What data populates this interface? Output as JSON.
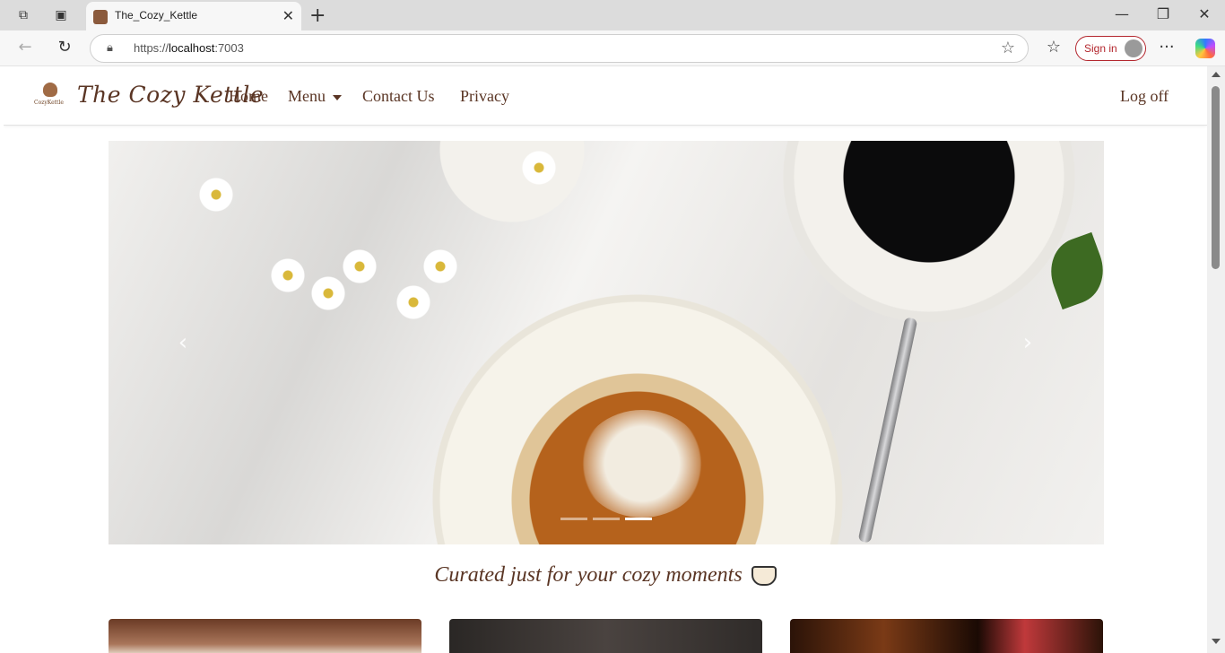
{
  "browser": {
    "tab_title": "The_Cozy_Kettle",
    "url_host_prefix": "https://",
    "url_host": "localhost",
    "url_port": ":7003",
    "signin_label": "Sign in"
  },
  "site": {
    "logo_text": "CozyKettle",
    "brand": "The Cozy Kettle",
    "nav": {
      "home": "Home",
      "menu": "Menu",
      "contact": "Contact Us",
      "privacy": "Privacy",
      "logoff": "Log off"
    },
    "carousel": {
      "slide_count": 3,
      "active_slide": 3
    },
    "tagline": "Curated just for your cozy moments"
  },
  "colors": {
    "brand_brown": "#5a3524",
    "signin_red": "#b3262d"
  }
}
